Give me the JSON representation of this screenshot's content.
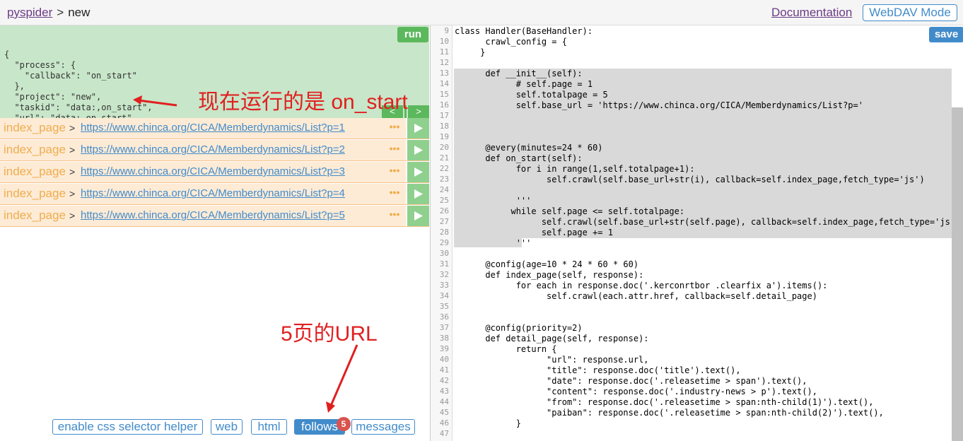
{
  "header": {
    "project_link": "pyspider",
    "separator": ">",
    "current": "new",
    "doc_link": "Documentation",
    "webdav_button": "WebDAV Mode"
  },
  "task_panel": {
    "run_label": "run",
    "json_lines": [
      "{",
      "  \"process\": {",
      "    \"callback\": \"on_start\"",
      "  },",
      "  \"project\": \"new\",",
      "  \"taskid\": \"data:,on_start\",",
      "  \"url\": \"data:,on_start\"",
      "}"
    ],
    "prev_label": "<",
    "next_label": ">",
    "sep_label": "|"
  },
  "follows": [
    {
      "callback": "index_page",
      "sep": ">",
      "url": "https://www.chinca.org/CICA/Memberdynamics/List?p=1",
      "more": "•••"
    },
    {
      "callback": "index_page",
      "sep": ">",
      "url": "https://www.chinca.org/CICA/Memberdynamics/List?p=2",
      "more": "•••"
    },
    {
      "callback": "index_page",
      "sep": ">",
      "url": "https://www.chinca.org/CICA/Memberdynamics/List?p=3",
      "more": "•••"
    },
    {
      "callback": "index_page",
      "sep": ">",
      "url": "https://www.chinca.org/CICA/Memberdynamics/List?p=4",
      "more": "•••"
    },
    {
      "callback": "index_page",
      "sep": ">",
      "url": "https://www.chinca.org/CICA/Memberdynamics/List?p=5",
      "more": "•••"
    }
  ],
  "annotations": {
    "running": "现在运行的是 on_start",
    "five_pages": "5页的URL",
    "color": "#e02020"
  },
  "tabs": {
    "css_helper": "enable css selector helper",
    "web": "web",
    "html": "html",
    "follows": "follows",
    "follows_count": "5",
    "messages": "messages"
  },
  "editor": {
    "save_label": "save",
    "line_numbers": [
      "9",
      "10",
      "11",
      "12",
      "13",
      "14",
      "15",
      "16",
      "17",
      "18",
      "19",
      "20",
      "21",
      "22",
      "23",
      "24",
      "25",
      "26",
      "27",
      "28",
      "29",
      "30",
      "31",
      "32",
      "33",
      "34",
      "35",
      "36",
      "37",
      "38",
      "39",
      "40",
      "41",
      "42",
      "43",
      "44",
      "45",
      "46",
      "47"
    ],
    "code_lines": [
      "class Handler(BaseHandler):",
      "      crawl_config = {",
      "     }",
      "",
      "      def __init__(self):",
      "            # self.page = 1",
      "            self.totalpage = 5",
      "            self.base_url = 'https://www.chinca.org/CICA/Memberdynamics/List?p='",
      "",
      "",
      "",
      "      @every(minutes=24 * 60)",
      "      def on_start(self):",
      "            for i in range(1,self.totalpage+1):",
      "                  self.crawl(self.base_url+str(i), callback=self.index_page,fetch_type='js')",
      "",
      "            '''",
      "           while self.page <= self.totalpage:",
      "                 self.crawl(self.base_url+str(self.page), callback=self.index_page,fetch_type='js')",
      "                 self.page += 1",
      "            '''",
      "",
      "      @config(age=10 * 24 * 60 * 60)",
      "      def index_page(self, response):",
      "            for each in response.doc('.kerconrtbor .clearfix a').items():",
      "                  self.crawl(each.attr.href, callback=self.detail_page)",
      "",
      "",
      "      @config(priority=2)",
      "      def detail_page(self, response):",
      "            return {",
      "                  \"url\": response.url,",
      "                  \"title\": response.doc('title').text(),",
      "                  \"date\": response.doc('.releasetime > span').text(),",
      "                  \"content\": response.doc('.industry-news > p').text(),",
      "                  \"from\": response.doc('.releasetime > span:nth-child(1)').text(),",
      "                  \"paiban\": response.doc('.releasetime > span:nth-child(2)').text(),",
      "            }",
      ""
    ]
  },
  "colors": {
    "task_bg": "#c8e6c9",
    "follow_bg": "#fdebd6",
    "accent": "#428bca",
    "run_green": "#5cb85c"
  }
}
